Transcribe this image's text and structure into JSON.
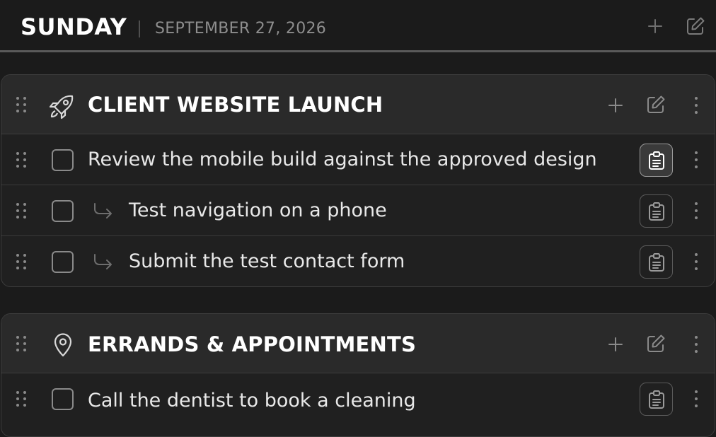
{
  "header": {
    "day": "SUNDAY",
    "date": "SEPTEMBER 27, 2026",
    "add_icon": "plus-icon",
    "edit_icon": "edit-icon"
  },
  "groups": [
    {
      "title": "CLIENT WEBSITE LAUNCH",
      "icon": "rocket-icon",
      "tasks": [
        {
          "text": "Review the mobile build against the approved design",
          "checked": false,
          "subtask": false,
          "clipboard_active": true
        },
        {
          "text": "Test navigation on a phone",
          "checked": false,
          "subtask": true,
          "clipboard_active": false
        },
        {
          "text": "Submit the test contact form",
          "checked": false,
          "subtask": true,
          "clipboard_active": false
        }
      ]
    },
    {
      "title": "ERRANDS & APPOINTMENTS",
      "icon": "map-pin-icon",
      "tasks": [
        {
          "text": "Call the dentist to book a cleaning",
          "checked": false,
          "subtask": false,
          "clipboard_active": false
        }
      ]
    }
  ],
  "colors": {
    "background": "#1b1b1b",
    "card_header": "#2a2a2a",
    "card_body": "#202020",
    "text_primary": "#ffffff",
    "text_muted": "#8e8e8e"
  }
}
